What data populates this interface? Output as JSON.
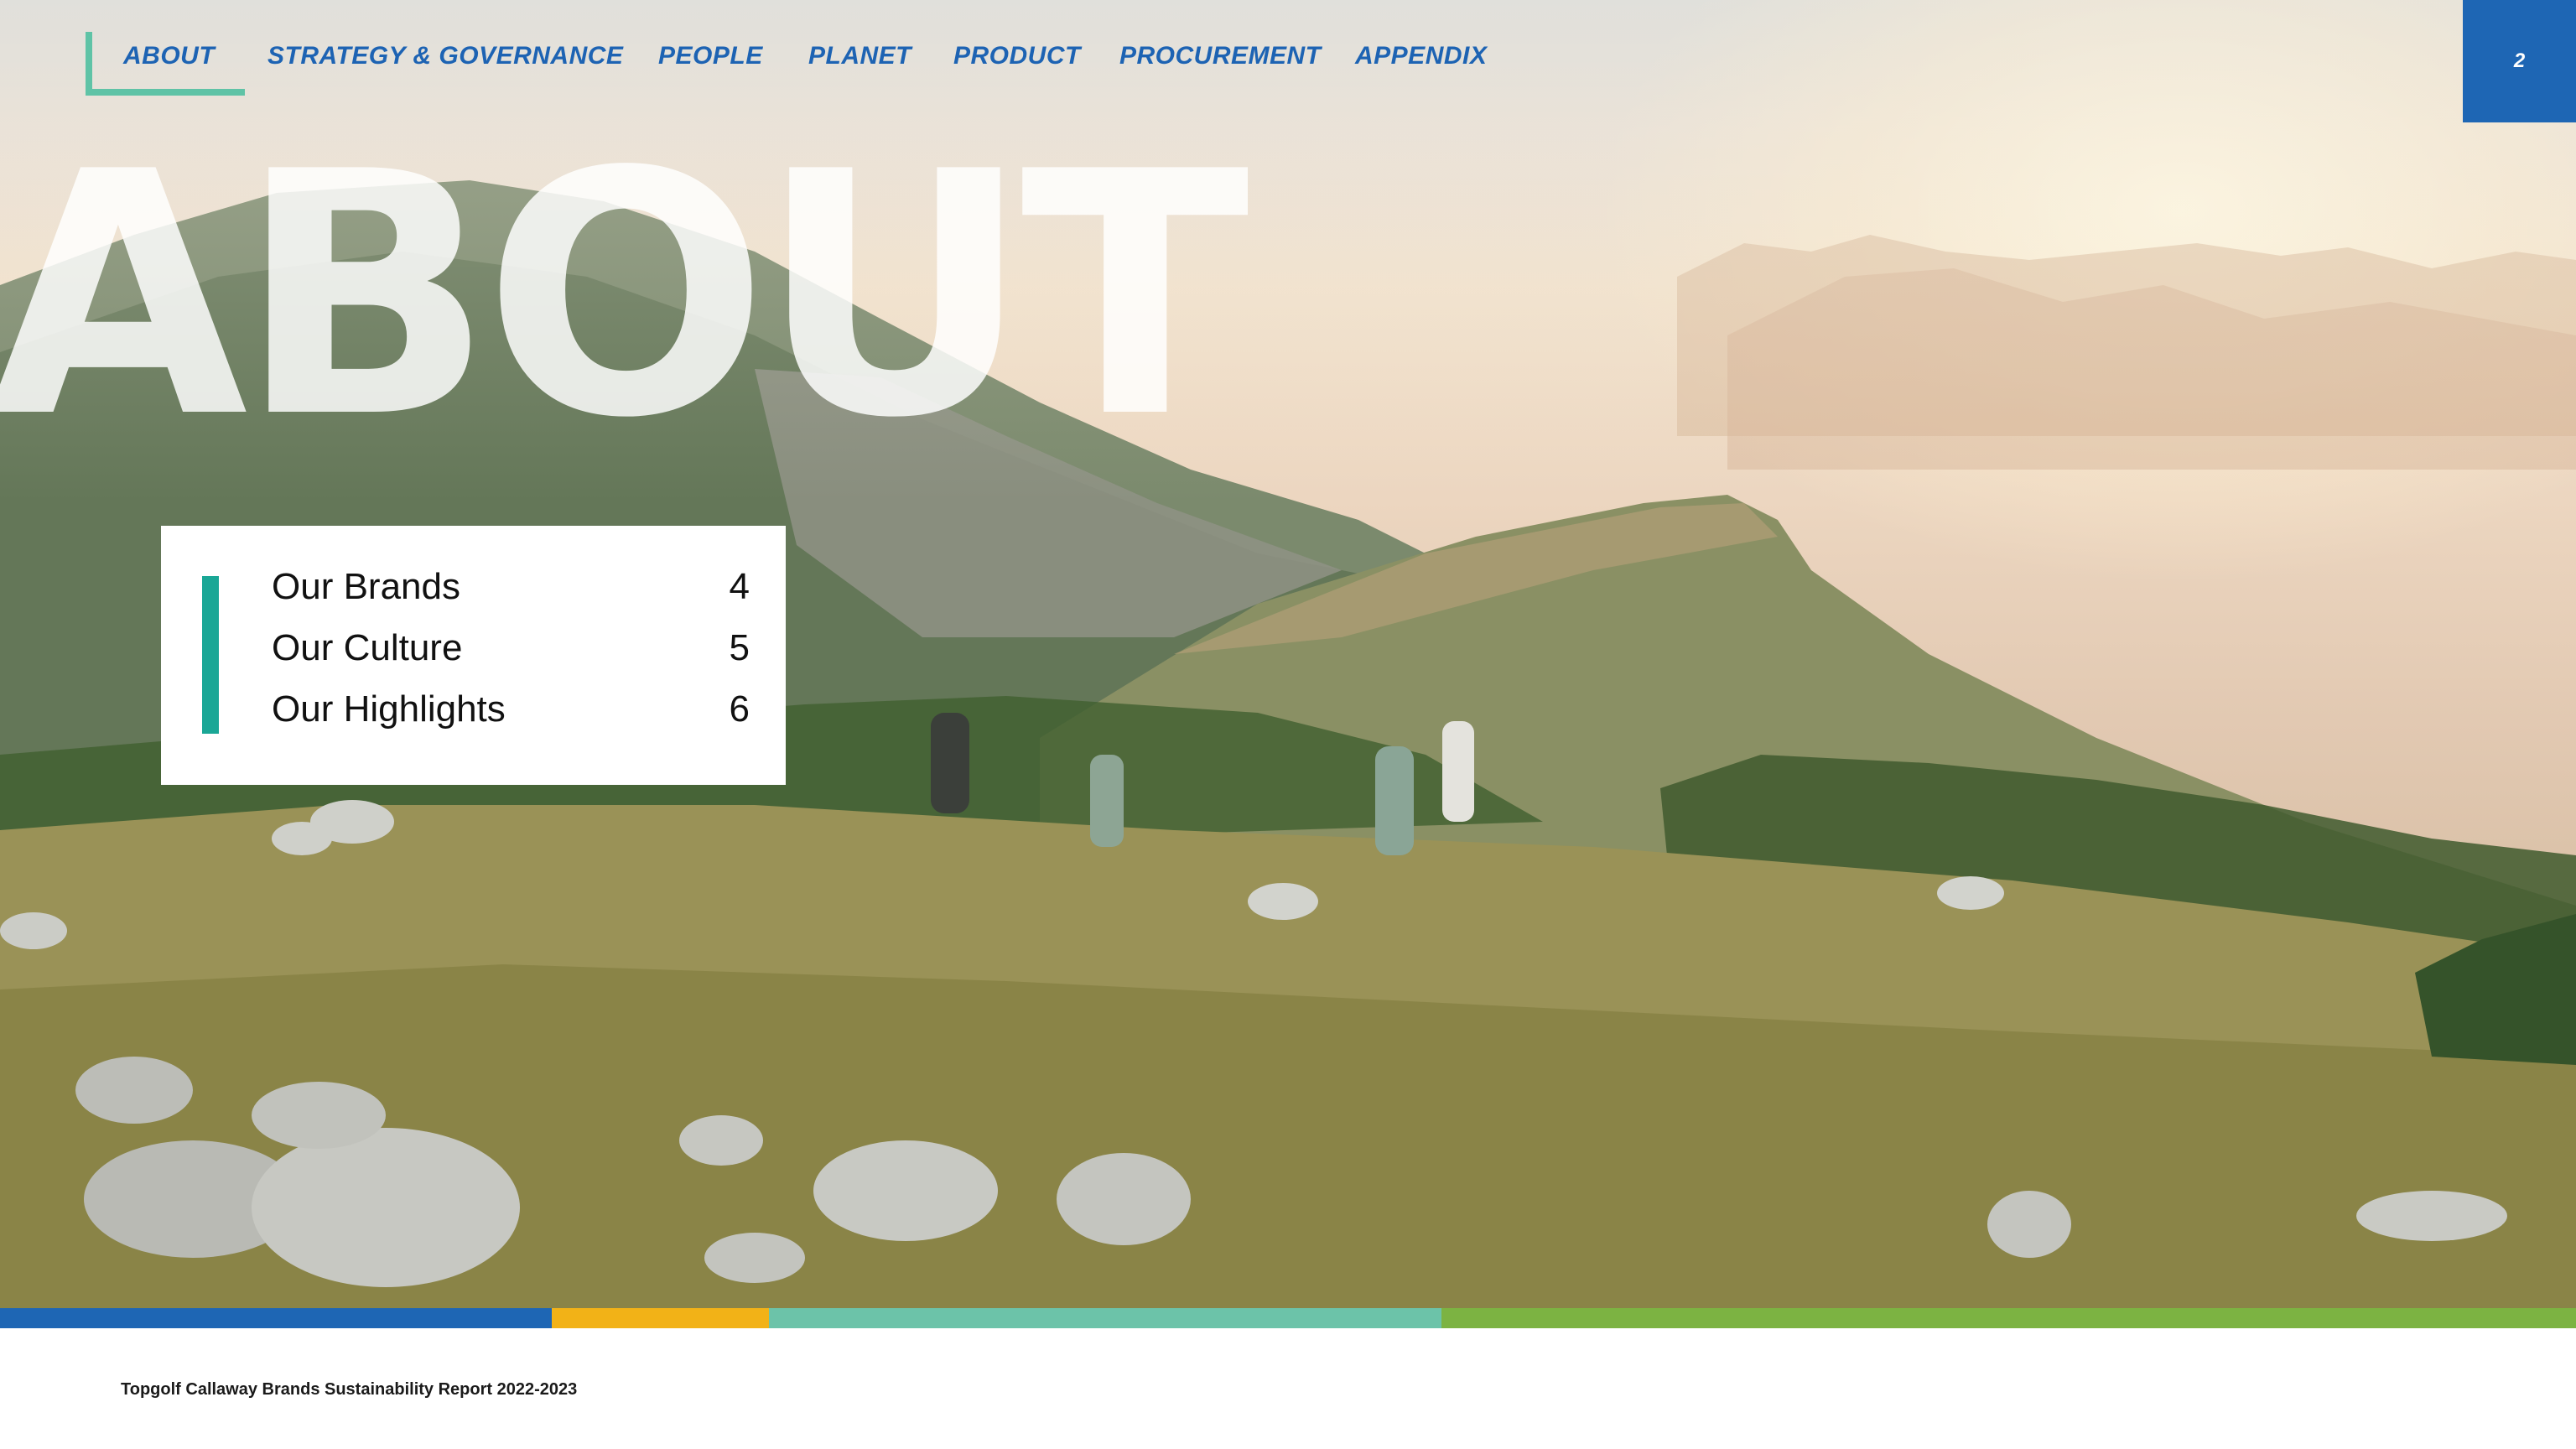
{
  "nav": {
    "items": [
      {
        "label": "ABOUT"
      },
      {
        "label": "STRATEGY & GOVERNANCE"
      },
      {
        "label": "PEOPLE"
      },
      {
        "label": "PLANET"
      },
      {
        "label": "PRODUCT"
      },
      {
        "label": "PROCUREMENT"
      },
      {
        "label": "APPENDIX"
      }
    ],
    "active": "ABOUT",
    "active_color": "#5fc3a6",
    "link_color": "#1d63b3"
  },
  "page_number": "2",
  "title": "ABOUT",
  "toc": [
    {
      "label": "Our Brands",
      "page": "4"
    },
    {
      "label": "Our Culture",
      "page": "5"
    },
    {
      "label": "Our Highlights",
      "page": "6"
    }
  ],
  "colors": {
    "blue": "#1e66b4",
    "yellow": "#f2b217",
    "teal": "#6cc3a9",
    "green": "#7cb342",
    "toc_accent": "#1aa796"
  },
  "footer": {
    "text": "Topgolf Callaway Brands Sustainability Report 2022-2023"
  }
}
